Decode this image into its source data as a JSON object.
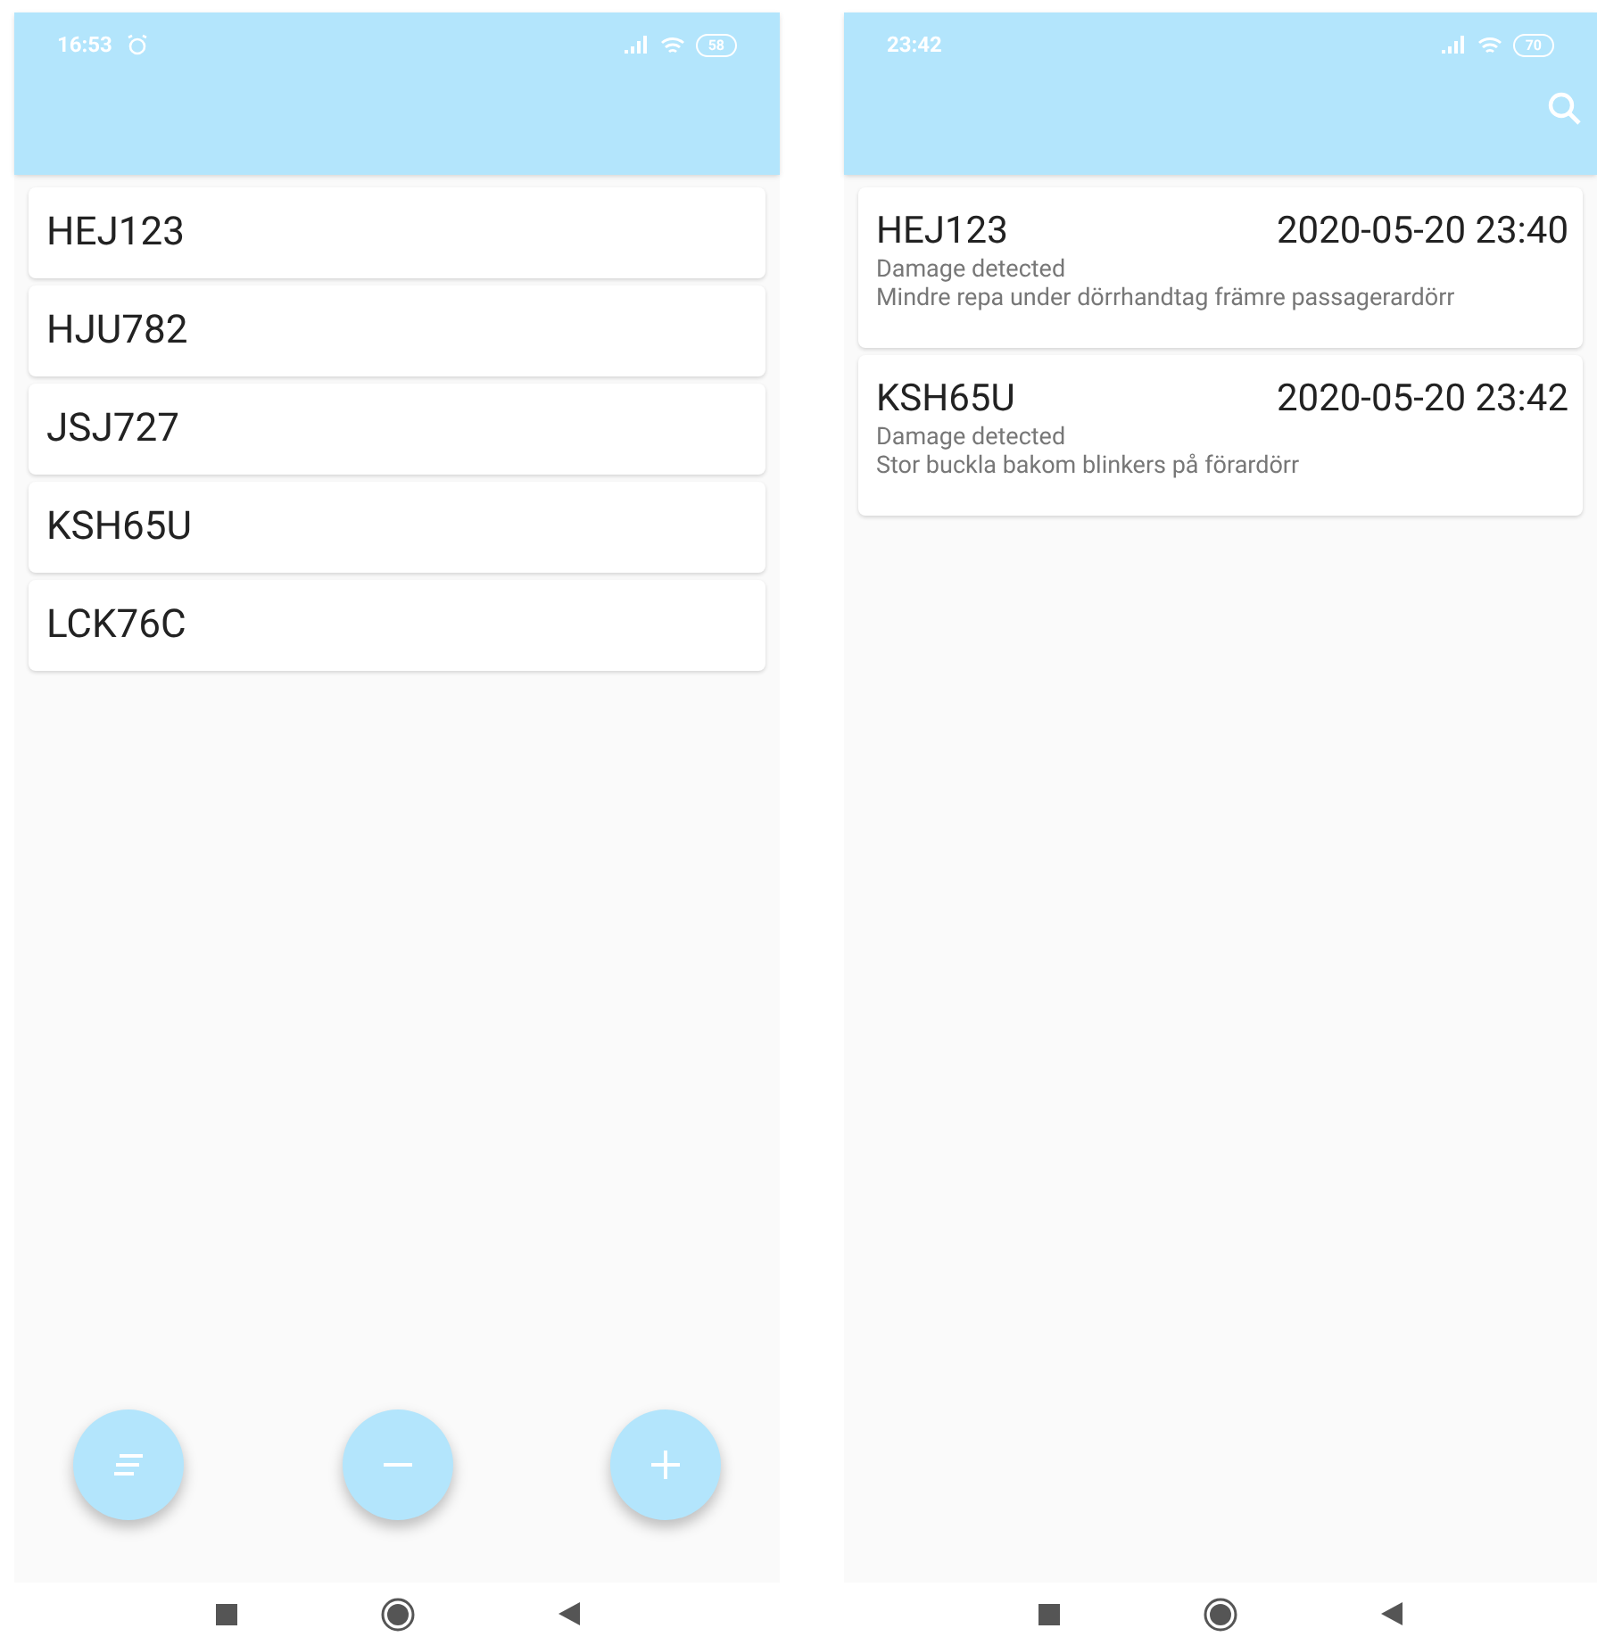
{
  "screens": [
    {
      "status_bar": {
        "time": "16:53",
        "alarm": true,
        "battery": "58"
      },
      "search": false,
      "plates": [
        "HEJ123",
        "HJU782",
        "JSJ727",
        "KSH65U",
        "LCK76C"
      ],
      "fabs": [
        {
          "kind": "notes"
        },
        {
          "kind": "minus"
        },
        {
          "kind": "plus"
        }
      ]
    },
    {
      "status_bar": {
        "time": "23:42",
        "alarm": false,
        "battery": "70"
      },
      "search": true,
      "reports": [
        {
          "plate": "HEJ123",
          "time": "2020-05-20 23:40",
          "status": "Damage detected",
          "description": "Mindre repa under dörrhandtag främre passagerardörr"
        },
        {
          "plate": "KSH65U",
          "time": "2020-05-20 23:42",
          "status": "Damage detected",
          "description": "Stor buckla bakom blinkers på förardörr"
        }
      ]
    }
  ]
}
